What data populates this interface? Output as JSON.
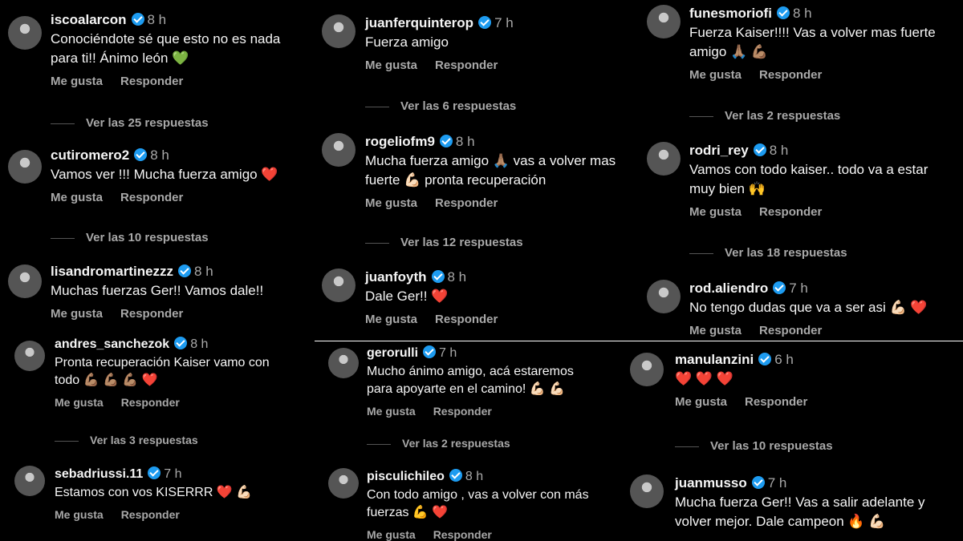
{
  "labels": {
    "like": "Me gusta",
    "reply": "Responder"
  },
  "colors": {
    "background": "#000000",
    "verified": "#1d9bf0",
    "muted": "#a8a8a8",
    "heart": "#ff3067"
  },
  "panels": [
    {
      "comments": [
        {
          "user": "iscoalarcon",
          "time": "8 h",
          "text": "Conociéndote sé que esto no es nada para ti!! Ánimo león 💚",
          "replies": "Ver las 25 respuestas"
        },
        {
          "user": "cutiromero2",
          "time": "8 h",
          "text": "Vamos ver !!! Mucha fuerza amigo ❤️",
          "replies": "Ver las 10 respuestas"
        },
        {
          "user": "lisandromartinezzz",
          "time": "8 h",
          "text": "Muchas fuerzas Ger!! Vamos dale!!",
          "replies": ""
        }
      ]
    },
    {
      "comments": [
        {
          "user": "andres_sanchezok",
          "time": "8 h",
          "text": "Pronta recuperación Kaiser vamo con todo 💪🏽 💪🏽 💪🏽 ❤️",
          "replies": "Ver las 3 respuestas"
        },
        {
          "user": "sebadriussi.11",
          "time": "7 h",
          "text": "Estamos con vos KISERRR ❤️ 💪🏻",
          "replies": ""
        }
      ]
    },
    {
      "comments": [
        {
          "user": "juanferquinterop",
          "time": "7 h",
          "text": "Fuerza amigo",
          "replies": "Ver las 6 respuestas"
        },
        {
          "user": "rogeliofm9",
          "time": "8 h",
          "text": "Mucha fuerza amigo 🙏🏽 vas a volver mas fuerte 💪🏻 pronta recuperación",
          "replies": "Ver las 12 respuestas"
        },
        {
          "user": "juanfoyth",
          "time": "8 h",
          "text": "Dale Ger!! ❤️",
          "replies": ""
        }
      ]
    },
    {
      "comments": [
        {
          "user": "funesmoriofi",
          "time": "8 h",
          "text": "Fuerza Kaiser!!!! Vas a volver mas fuerte amigo 🙏🏽 💪🏽",
          "replies": "Ver las 2 respuestas"
        },
        {
          "user": "rodri_rey",
          "time": "8 h",
          "text": "Vamos con todo kaiser.. todo va a estar muy bien 🙌",
          "replies": "Ver las 18 respuestas"
        },
        {
          "user": "rod.aliendro",
          "time": "7 h",
          "text": "No tengo dudas que va a ser asi 💪🏻 ❤️",
          "replies": ""
        }
      ]
    },
    {
      "comments": [
        {
          "user": "gerorulli",
          "time": "7 h",
          "text": "Mucho ánimo amigo, acá estaremos para apoyarte en el camino! 💪🏻 💪🏻",
          "replies": "Ver las 2 respuestas"
        },
        {
          "user": "pisculichileo",
          "time": "8 h",
          "text": "Con todo amigo , vas a volver con más fuerzas 💪 ❤️",
          "replies": ""
        }
      ]
    },
    {
      "comments": [
        {
          "user": "manulanzini",
          "time": "6 h",
          "text": "❤️ ❤️ ❤️",
          "replies": "Ver las 10 respuestas"
        },
        {
          "user": "juanmusso",
          "time": "7 h",
          "text": "Mucha fuerza Ger!! Vas a salir adelante y volver mejor. Dale campeon 🔥 💪🏻",
          "replies": ""
        }
      ]
    }
  ]
}
